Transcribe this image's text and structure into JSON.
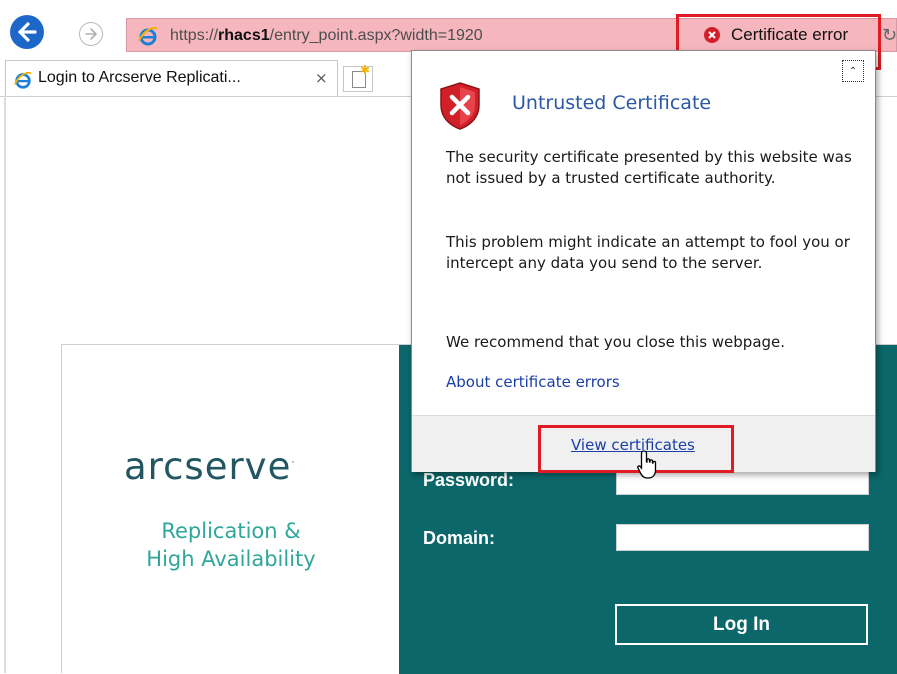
{
  "browser": {
    "address": {
      "url_prefix": "https://",
      "url_host": "rhacs1",
      "url_rest": "/entry_point.aspx?width=1920",
      "certificate_error_label": "Certificate error"
    },
    "tab": {
      "title": "Login to Arcserve Replicati...",
      "close_glyph": "×"
    }
  },
  "popup": {
    "title": "Untrusted Certificate",
    "paragraph1": "The security certificate presented by this website was not issued by a trusted certificate authority.",
    "paragraph2": "This problem might indicate an attempt to fool you or intercept any data you send to the server.",
    "paragraph3": "We recommend that you close this webpage.",
    "about_link": "About certificate errors",
    "view_certificates": "View certificates"
  },
  "login": {
    "brand": "arcserve",
    "brand_mark": "·",
    "tagline_line1": "Replication &",
    "tagline_line2": "High Availability",
    "password_label": "Password:",
    "domain_label": "Domain:",
    "login_button": "Log In"
  },
  "colors": {
    "address_error_bg": "#f5b6be",
    "highlight_red": "#e01b24",
    "login_panel": "#0b6769",
    "brand_dark": "#225762",
    "brand_teal": "#2fa79a",
    "link_blue": "#1a3ea8"
  }
}
